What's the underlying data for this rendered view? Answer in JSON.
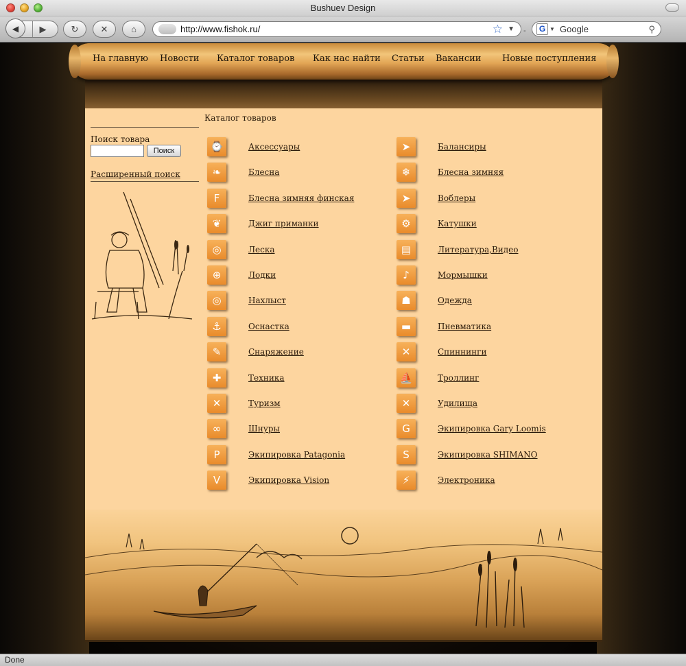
{
  "window": {
    "title": "Bushuev Design"
  },
  "toolbar": {
    "back_glyph": "◀",
    "forward_glyph": "▶",
    "reload_glyph": "↻",
    "stop_glyph": "✕",
    "home_glyph": "⌂",
    "url": "http://www.fishok.ru/",
    "search_placeholder": "Google",
    "search_engine_glyph": "G"
  },
  "status": {
    "text": "Done"
  },
  "nav": [
    {
      "label": "На главную"
    },
    {
      "label": "Новости"
    },
    {
      "label": "Каталог товаров"
    },
    {
      "label": "Как нас найти"
    },
    {
      "label": "Статьи"
    },
    {
      "label": "Вакансии"
    },
    {
      "label": "Новые поступления"
    }
  ],
  "sidebar": {
    "search_label": "Поиск товара",
    "search_value": "",
    "search_button": "Поиск",
    "advanced_search": "Расширенный поиск"
  },
  "catalog": {
    "title": "Каталог товаров",
    "left": [
      {
        "label": "Аксессуары",
        "icon": "watch-icon",
        "glyph": "⌚"
      },
      {
        "label": "Блесна",
        "icon": "spoon-lure-icon",
        "glyph": "❧"
      },
      {
        "label": "Блесна зимняя финская",
        "icon": "finnish-lure-icon",
        "glyph": "F"
      },
      {
        "label": "Джиг приманки",
        "icon": "jig-icon",
        "glyph": "❦"
      },
      {
        "label": "Леска",
        "icon": "line-spool-icon",
        "glyph": "◎"
      },
      {
        "label": "Лодки",
        "icon": "boat-icon",
        "glyph": "⊕"
      },
      {
        "label": "Нахлыст",
        "icon": "fly-line-icon",
        "glyph": "◎"
      },
      {
        "label": "Оснастка",
        "icon": "hook-icon",
        "glyph": "⚓"
      },
      {
        "label": "Снаряжение",
        "icon": "gear-equipment-icon",
        "glyph": "✎"
      },
      {
        "label": "Техника",
        "icon": "wrench-icon",
        "glyph": "✚"
      },
      {
        "label": "Туризм",
        "icon": "cutlery-icon",
        "glyph": "✕"
      },
      {
        "label": "Шнуры",
        "icon": "cord-icon",
        "glyph": "∞"
      },
      {
        "label": "Экипировка Patagonia",
        "icon": "patagonia-icon",
        "glyph": "P"
      },
      {
        "label": "Экипировка Vision",
        "icon": "vision-icon",
        "glyph": "V"
      }
    ],
    "right": [
      {
        "label": "Балансиры",
        "icon": "balancer-fish-icon",
        "glyph": "➤"
      },
      {
        "label": "Блесна зимняя",
        "icon": "winter-lure-icon",
        "glyph": "❄"
      },
      {
        "label": "Воблеры",
        "icon": "wobbler-fish-icon",
        "glyph": "➤"
      },
      {
        "label": "Катушки",
        "icon": "reel-icon",
        "glyph": "⚙"
      },
      {
        "label": "Литература,Видео",
        "icon": "book-icon",
        "glyph": "▤"
      },
      {
        "label": "Мормышки",
        "icon": "jig-fly-icon",
        "glyph": "♪"
      },
      {
        "label": "Одежда",
        "icon": "clothing-icon",
        "glyph": "☗"
      },
      {
        "label": "Пневматика",
        "icon": "air-gun-icon",
        "glyph": "▬"
      },
      {
        "label": "Спиннинги",
        "icon": "spinning-rods-icon",
        "glyph": "✕"
      },
      {
        "label": "Троллинг",
        "icon": "trolling-icon",
        "glyph": "⛵"
      },
      {
        "label": "Удилища",
        "icon": "rods-icon",
        "glyph": "✕"
      },
      {
        "label": "Экипировка Gary Loomis",
        "icon": "gary-loomis-icon",
        "glyph": "G"
      },
      {
        "label": "Экипировка SHIMANO",
        "icon": "shimano-icon",
        "glyph": "S"
      },
      {
        "label": "Электроника",
        "icon": "electronics-icon",
        "glyph": "⚡"
      }
    ]
  }
}
